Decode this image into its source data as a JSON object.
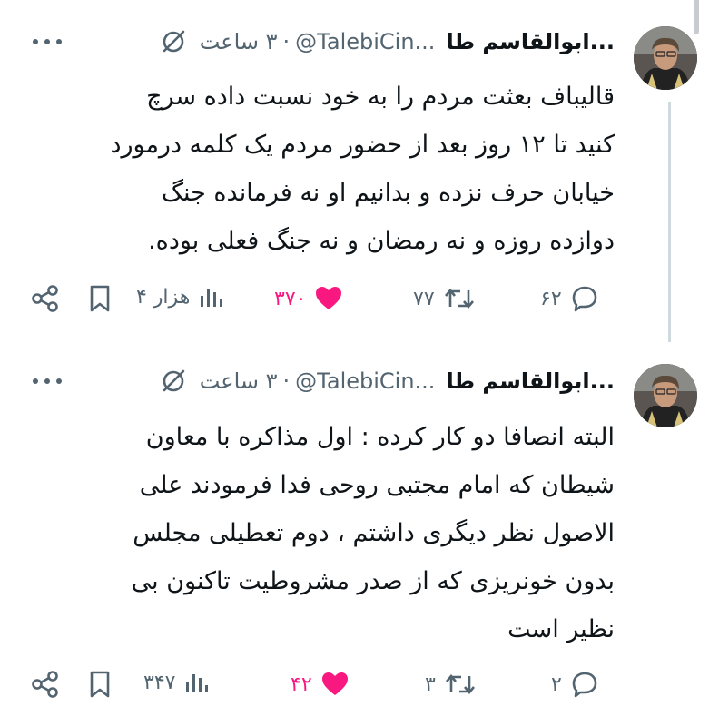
{
  "colors": {
    "text": "#0f1419",
    "muted": "#536471",
    "like": "#f91880",
    "divider": "#cfd9de"
  },
  "tweets": [
    {
      "author": {
        "name": "ابوالقاسم طا...",
        "handle": "@TalebiCin...",
        "time": "۳ ساعت",
        "avatar_icon": "user-photo"
      },
      "text_lines": [
        "قالیباف بعثت مردم را به خود نسبت داده سرچ",
        "کنید تا ۱۲ روز بعد از حضور مردم  یک کلمه درمورد",
        "خیابان حرف نزده و بدانیم او نه فرمانده جنگ",
        "دوازده روزه و نه رمضان و نه جنگ فعلی بوده."
      ],
      "stats": {
        "replies": "۶۲",
        "retweets": "۷۷",
        "likes": "۳۷۰",
        "views": "۴ هزار"
      }
    },
    {
      "author": {
        "name": "ابوالقاسم طا...",
        "handle": "@TalebiCin...",
        "time": "۳ ساعت",
        "avatar_icon": "user-photo"
      },
      "text_lines": [
        "البته انصافا دو کار کرده : اول مذاکره با معاون",
        "شیطان که امام مجتبی روحی فدا فرمودند علی",
        "الاصول نظر دیگری داشتم ، دوم تعطیلی مجلس",
        "بدون خونریزی که از صدر مشروطیت تاکنون بی",
        "نظیر است"
      ],
      "stats": {
        "replies": "۲",
        "retweets": "۳",
        "likes": "۴۲",
        "views": "۳۴۷"
      }
    }
  ]
}
